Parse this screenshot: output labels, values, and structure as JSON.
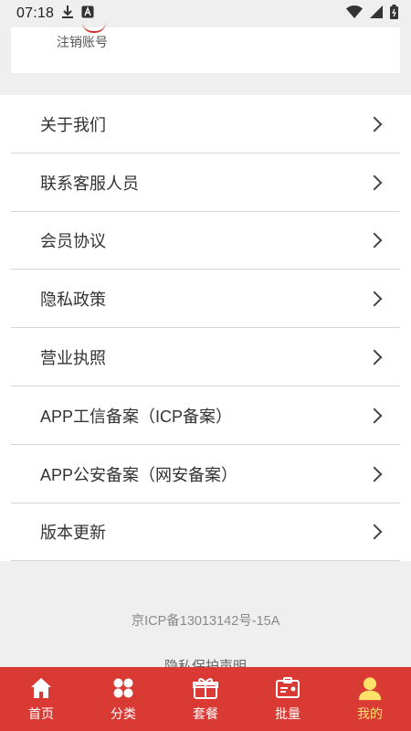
{
  "status_bar": {
    "time": "07:18"
  },
  "account": {
    "cancel_label": "注销账号"
  },
  "menu": [
    {
      "label": "关于我们"
    },
    {
      "label": "联系客服人员"
    },
    {
      "label": "会员协议"
    },
    {
      "label": "隐私政策"
    },
    {
      "label": "营业执照"
    },
    {
      "label": "APP工信备案（ICP备案）"
    },
    {
      "label": "APP公安备案（网安备案）"
    },
    {
      "label": "版本更新"
    }
  ],
  "footer": {
    "icp": "京ICP备13013142号-15A",
    "privacy": "隐私保护声明"
  },
  "tabbar": {
    "items": [
      {
        "label": "首页",
        "icon": "home-icon"
      },
      {
        "label": "分类",
        "icon": "category-icon"
      },
      {
        "label": "套餐",
        "icon": "gift-icon"
      },
      {
        "label": "批量",
        "icon": "id-card-icon"
      },
      {
        "label": "我的",
        "icon": "user-icon"
      }
    ],
    "active_index": 4,
    "active_color": "#ffe16a",
    "background_color": "#d93a34"
  }
}
